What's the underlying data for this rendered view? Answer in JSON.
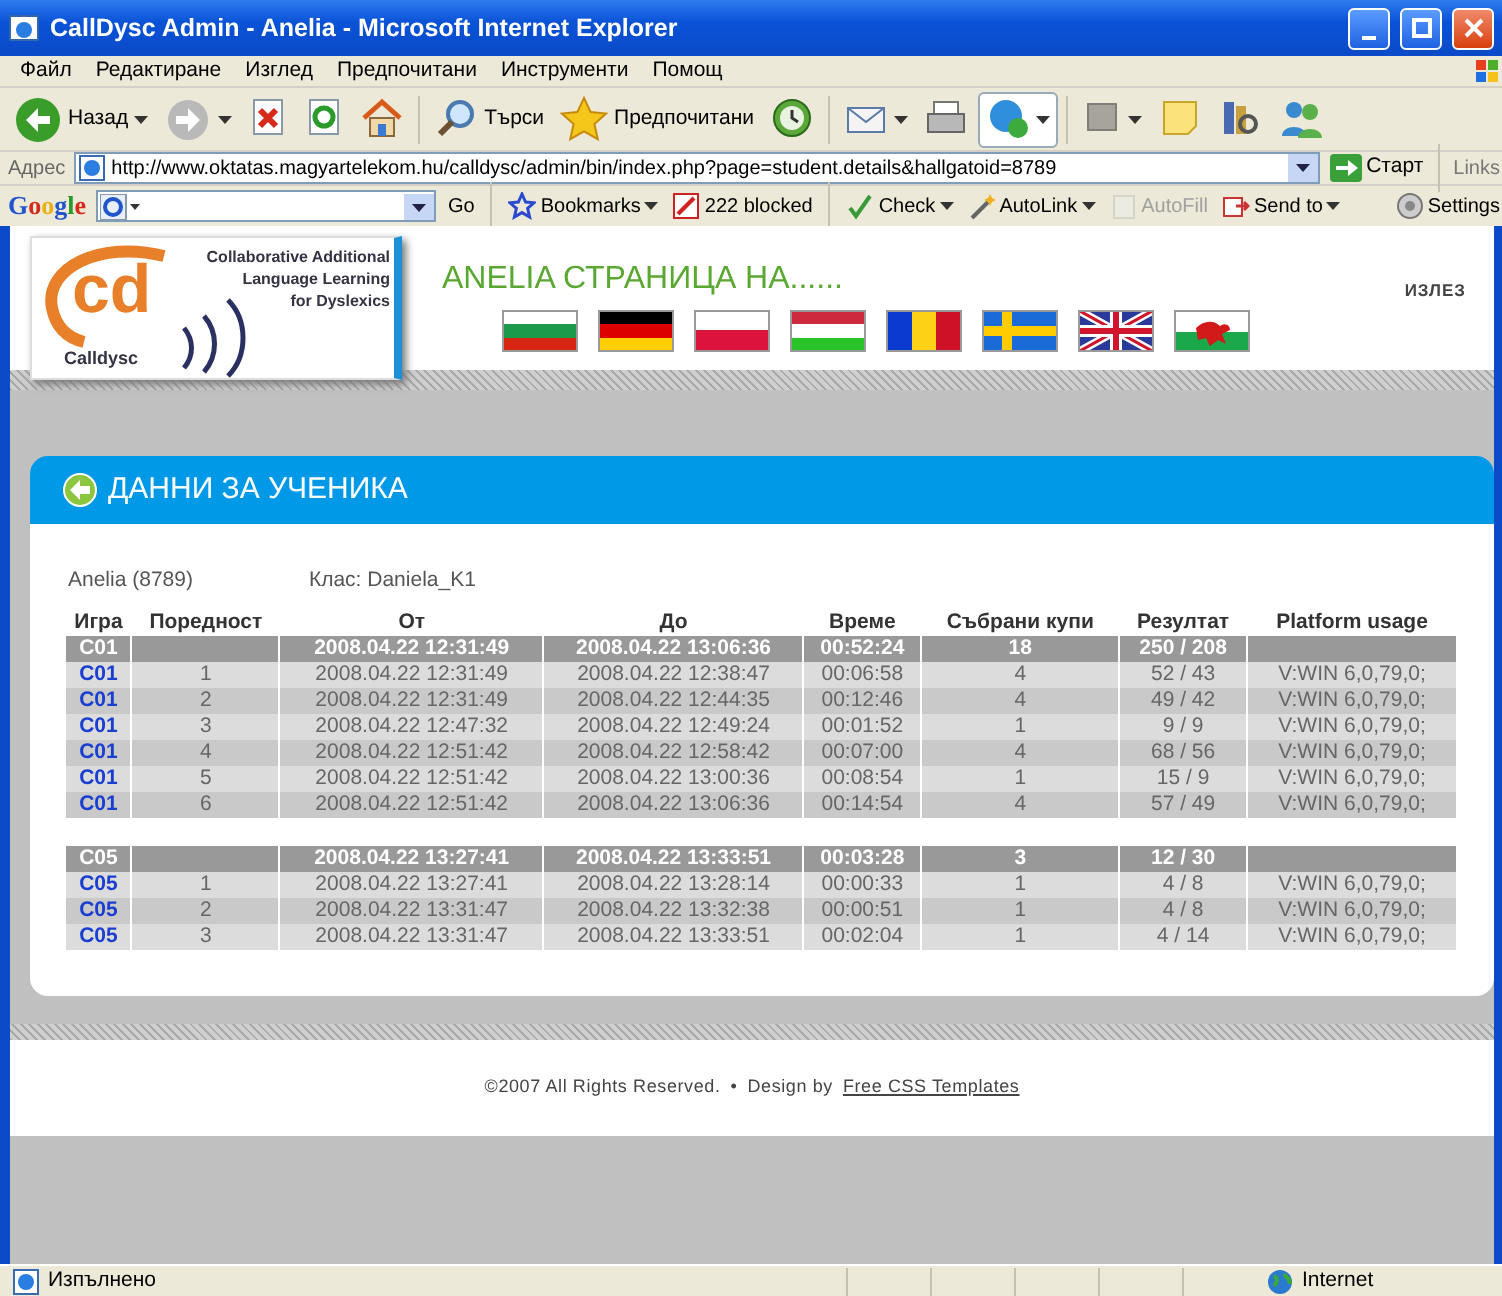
{
  "window": {
    "title": "CallDysc Admin - Anelia - Microsoft Internet Explorer"
  },
  "menu": [
    "Файл",
    "Редактиране",
    "Изглед",
    "Предпочитани",
    "Инструменти",
    "Помощ"
  ],
  "toolbar": {
    "buttons": [
      {
        "kind": "back",
        "label": "Назад",
        "dropdown": true
      },
      {
        "kind": "forward",
        "dropdown": true
      },
      {
        "kind": "stop",
        "dropdown": false
      },
      {
        "kind": "refresh",
        "dropdown": false
      },
      {
        "kind": "home",
        "dropdown": false
      },
      {
        "kind": "search",
        "label": "Търси",
        "dropdown": false
      },
      {
        "kind": "favorites",
        "label": "Предпочитани",
        "dropdown": false
      },
      {
        "kind": "history",
        "dropdown": false
      },
      {
        "kind": "mail",
        "dropdown": true
      },
      {
        "kind": "print",
        "dropdown": false
      },
      {
        "kind": "messenger",
        "dropdown": true
      },
      {
        "kind": "square",
        "dropdown": true
      },
      {
        "kind": "note",
        "dropdown": false
      },
      {
        "kind": "research",
        "dropdown": false
      },
      {
        "kind": "people",
        "dropdown": false
      }
    ]
  },
  "address": {
    "label": "Адрес",
    "url": "http://www.oktatas.magyartelekom.hu/calldysc/admin/bin/index.php?page=student.details&hallgatoid=8789",
    "go": "Старт",
    "links": "Links"
  },
  "google_toolbar": {
    "logo": "Google",
    "go": "Go",
    "items": [
      {
        "kind": "bookmarks",
        "label": "Bookmarks",
        "disabled": false
      },
      {
        "kind": "blocked",
        "label": "222 blocked",
        "disabled": false
      },
      {
        "kind": "check",
        "label": "Check",
        "disabled": false
      },
      {
        "kind": "autolink",
        "label": "AutoLink",
        "disabled": false
      },
      {
        "kind": "autofill",
        "label": "AutoFill",
        "disabled": true
      },
      {
        "kind": "sendto",
        "label": "Send to",
        "disabled": false
      },
      {
        "kind": "settings",
        "label": "Settings",
        "disabled": false
      }
    ]
  },
  "page": {
    "logo": {
      "letters": "cd",
      "tagline": [
        "Collaborative Additional",
        "Language Learning",
        "for Dyslexics"
      ],
      "name": "Calldysc"
    },
    "heading": "ANELIA СТРАНИЦА НА......",
    "flags": [
      {
        "kind": "bg"
      },
      {
        "kind": "de"
      },
      {
        "kind": "pl"
      },
      {
        "kind": "hu"
      },
      {
        "kind": "ro"
      },
      {
        "kind": "se"
      },
      {
        "kind": "gb"
      },
      {
        "kind": "wales"
      }
    ],
    "logout": "ИЗЛЕЗ",
    "panel_title": "ДАННИ ЗА УЧЕНИКА",
    "student": "Anelia (8789)",
    "class": "Клас: Daniela_K1",
    "table": {
      "columns": [
        "Игра",
        "Поредност",
        "От",
        "До",
        "Време",
        "Събрани купи",
        "Резултат",
        "Platform usage"
      ],
      "groups": [
        {
          "summary": {
            "game": "C01",
            "from": "2008.04.22 12:31:49",
            "to": "2008.04.22 13:06:36",
            "time": "00:52:24",
            "cups": "18",
            "result": "250 / 208"
          },
          "rows": [
            [
              "C01",
              "1",
              "2008.04.22 12:31:49",
              "2008.04.22 12:38:47",
              "00:06:58",
              "4",
              "52 / 43",
              "V:WIN 6,0,79,0;"
            ],
            [
              "C01",
              "2",
              "2008.04.22 12:31:49",
              "2008.04.22 12:44:35",
              "00:12:46",
              "4",
              "49 / 42",
              "V:WIN 6,0,79,0;"
            ],
            [
              "C01",
              "3",
              "2008.04.22 12:47:32",
              "2008.04.22 12:49:24",
              "00:01:52",
              "1",
              "9 / 9",
              "V:WIN 6,0,79,0;"
            ],
            [
              "C01",
              "4",
              "2008.04.22 12:51:42",
              "2008.04.22 12:58:42",
              "00:07:00",
              "4",
              "68 / 56",
              "V:WIN 6,0,79,0;"
            ],
            [
              "C01",
              "5",
              "2008.04.22 12:51:42",
              "2008.04.22 13:00:36",
              "00:08:54",
              "1",
              "15 / 9",
              "V:WIN 6,0,79,0;"
            ],
            [
              "C01",
              "6",
              "2008.04.22 12:51:42",
              "2008.04.22 13:06:36",
              "00:14:54",
              "4",
              "57 / 49",
              "V:WIN 6,0,79,0;"
            ]
          ]
        },
        {
          "summary": {
            "game": "C05",
            "from": "2008.04.22 13:27:41",
            "to": "2008.04.22 13:33:51",
            "time": "00:03:28",
            "cups": "3",
            "result": "12 / 30"
          },
          "rows": [
            [
              "C05",
              "1",
              "2008.04.22 13:27:41",
              "2008.04.22 13:28:14",
              "00:00:33",
              "1",
              "4 / 8",
              "V:WIN 6,0,79,0;"
            ],
            [
              "C05",
              "2",
              "2008.04.22 13:31:47",
              "2008.04.22 13:32:38",
              "00:00:51",
              "1",
              "4 / 8",
              "V:WIN 6,0,79,0;"
            ],
            [
              "C05",
              "3",
              "2008.04.22 13:31:47",
              "2008.04.22 13:33:51",
              "00:02:04",
              "1",
              "4 / 14",
              "V:WIN 6,0,79,0;"
            ]
          ]
        }
      ]
    },
    "footer": {
      "copyright": "©2007 All Rights Reserved.",
      "separator": "•",
      "design_by": "Design by",
      "link": "Free CSS Templates"
    }
  },
  "status_bar": {
    "text": "Изпълнено",
    "zone": "Internet"
  }
}
